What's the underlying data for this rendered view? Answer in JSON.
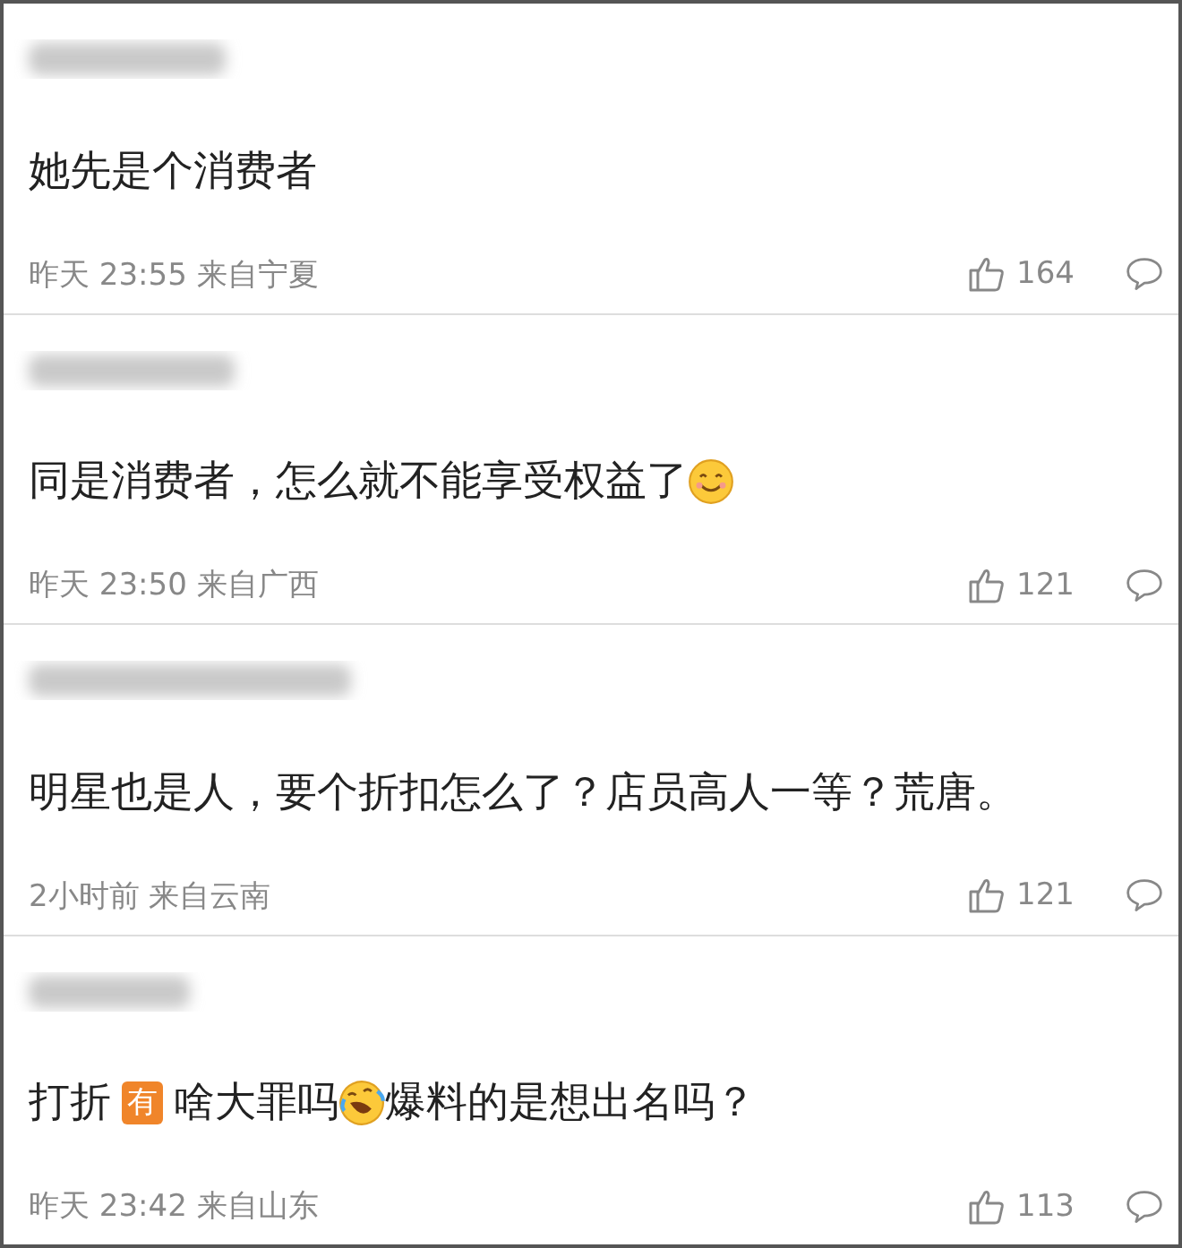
{
  "comments": [
    {
      "content": [
        {
          "kind": "text",
          "text": "她先是个消费者"
        }
      ],
      "time": "昨天 23:55",
      "source": "来自宁夏",
      "likes": "164"
    },
    {
      "content": [
        {
          "kind": "text",
          "text": "同是消费者，怎么就不能享受权益了"
        },
        {
          "kind": "smile"
        }
      ],
      "time": "昨天 23:50",
      "source": "来自广西",
      "likes": "121"
    },
    {
      "content": [
        {
          "kind": "text",
          "text": "明星也是人，要个折扣怎么了？店员高人一等？荒唐。"
        }
      ],
      "time": "2小时前",
      "source": "来自云南",
      "likes": "121"
    },
    {
      "content": [
        {
          "kind": "text",
          "text": "打折"
        },
        {
          "kind": "badge",
          "text": "有"
        },
        {
          "kind": "text",
          "text": "啥大罪吗"
        },
        {
          "kind": "laugh"
        },
        {
          "kind": "text",
          "text": "爆料的是想出名吗？"
        }
      ],
      "time": "昨天 23:42",
      "source": "来自山东",
      "likes": "113"
    }
  ]
}
